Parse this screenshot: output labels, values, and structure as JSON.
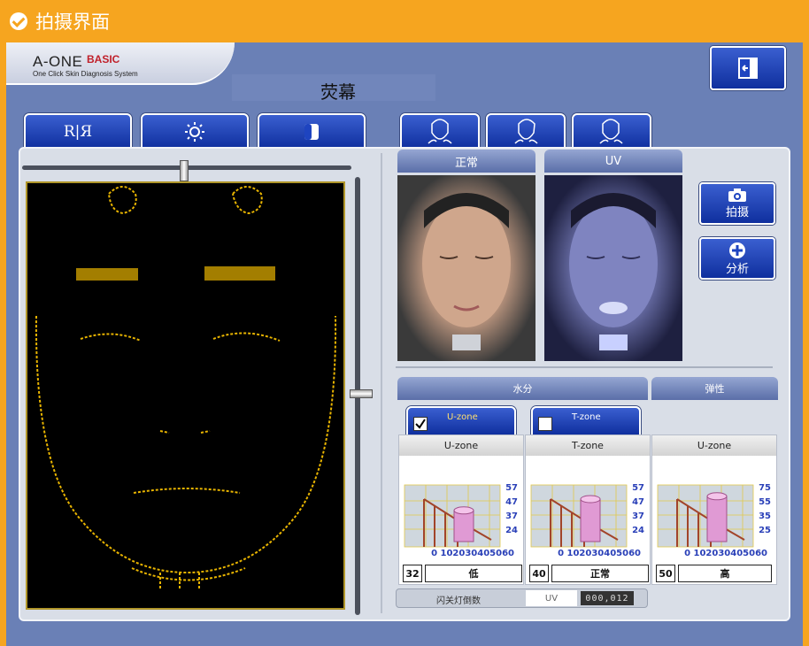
{
  "window": {
    "title": "拍摄界面"
  },
  "brand": {
    "name": "A-ONE",
    "edition": "BASIC",
    "tagline": "One Click Skin Diagnosis System"
  },
  "mode": {
    "label": "荧幕"
  },
  "toolbar": {
    "tools": [
      {
        "icon": "mirror-flip-icon",
        "label": "R|Я"
      },
      {
        "icon": "brightness-icon",
        "label": ""
      },
      {
        "icon": "contrast-icon",
        "label": ""
      }
    ],
    "face_views": [
      {
        "icon": "face-front-icon"
      },
      {
        "icon": "face-left-icon"
      },
      {
        "icon": "face-right-icon"
      }
    ],
    "exit_icon": "exit-door-icon"
  },
  "photos": {
    "normal": {
      "label": "正常"
    },
    "uv": {
      "label": "UV"
    }
  },
  "actions": {
    "capture": {
      "label": "拍摄",
      "icon": "camera-icon"
    },
    "analyze": {
      "label": "分析",
      "icon": "plus-icon"
    }
  },
  "sections": {
    "moisture": {
      "label": "水分"
    },
    "elasticity": {
      "label": "弹性"
    }
  },
  "zones": [
    {
      "label": "U-zone",
      "checked": true
    },
    {
      "label": "T-zone",
      "checked": false
    }
  ],
  "charts": [
    {
      "title": "U-zone",
      "y_ticks": [
        "57",
        "47",
        "37",
        "24"
      ],
      "x_ticks": "0 102030405060",
      "score": "32",
      "grade": "低",
      "level": 0.55
    },
    {
      "title": "T-zone",
      "y_ticks": [
        "57",
        "47",
        "37",
        "24"
      ],
      "x_ticks": "0 102030405060",
      "score": "40",
      "grade": "正常",
      "level": 0.75
    },
    {
      "title": "U-zone",
      "y_ticks": [
        "75",
        "55",
        "35",
        "25"
      ],
      "x_ticks": "0 102030405060",
      "score": "50",
      "grade": "高",
      "level": 0.8
    }
  ],
  "flash": {
    "label": "闪关灯倒数",
    "mode": "UV",
    "counter": "000,012"
  },
  "colors": {
    "accent": "#f6a51f",
    "panel_blue": "#6a80b6",
    "button_blue": "#1e44c0",
    "scan_line": "#e8b400"
  }
}
